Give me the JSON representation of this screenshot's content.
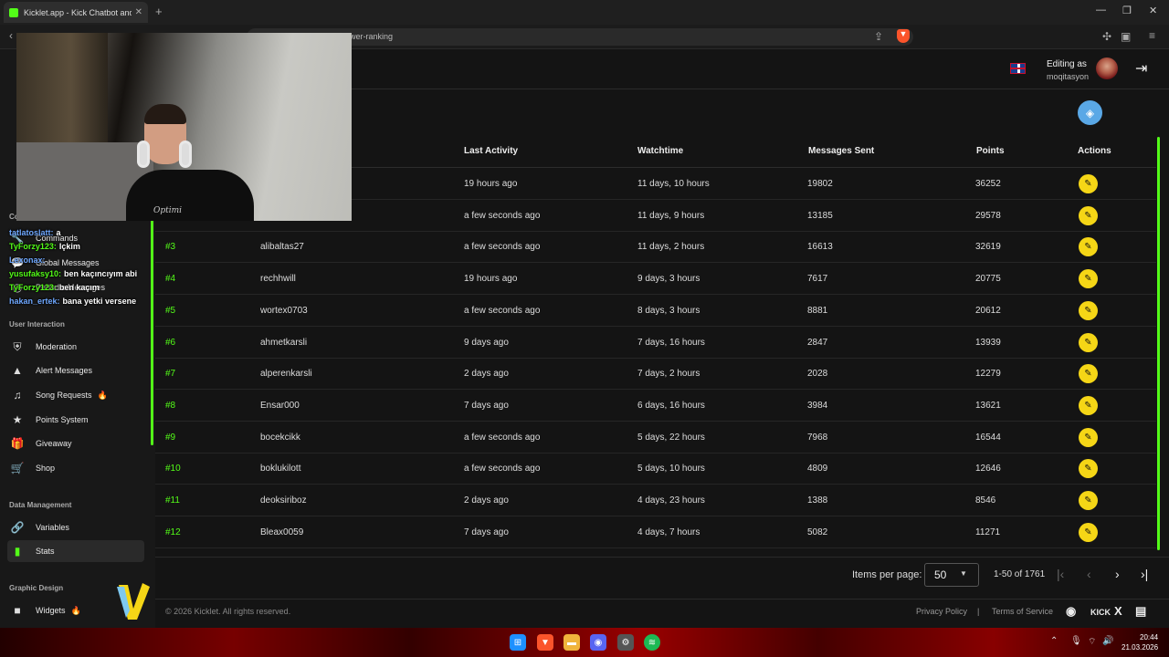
{
  "browser": {
    "tab_title": "Kicklet.app - Kick Chatbot and C",
    "tab_close": "✕",
    "new_tab": "+",
    "url": "iewer-ranking"
  },
  "header": {
    "editing_label": "Editing as",
    "username": "moqitasyon"
  },
  "sidebar": {
    "section_user_interaction": "User Interaction",
    "section_commands": "Co",
    "commands_items": [
      {
        "label": "Commands",
        "icon": "wrench-icon"
      },
      {
        "label": "Global Messages",
        "icon": "chat-bubble-icon"
      },
      {
        "label": "Periodic Messages",
        "icon": "clock-icon"
      }
    ],
    "user_interaction_items": [
      {
        "label": "Moderation",
        "icon": "shield-icon",
        "badge": ""
      },
      {
        "label": "Alert Messages",
        "icon": "alert-icon",
        "badge": ""
      },
      {
        "label": "Song Requests",
        "icon": "music-icon",
        "badge": "🔥"
      },
      {
        "label": "Points System",
        "icon": "star-icon",
        "badge": ""
      },
      {
        "label": "Giveaway",
        "icon": "gift-icon",
        "badge": ""
      },
      {
        "label": "Shop",
        "icon": "cart-icon",
        "badge": ""
      }
    ],
    "section_data_management": "Data Management",
    "data_items": [
      {
        "label": "Variables",
        "icon": "link-icon"
      },
      {
        "label": "Stats",
        "icon": "bar-chart-icon",
        "active": true
      }
    ],
    "section_graphic_design": "Graphic Design",
    "graphic_items": [
      {
        "label": "Widgets",
        "icon": "video-icon",
        "badge": "🔥"
      }
    ]
  },
  "table": {
    "columns": [
      "Last Activity",
      "Watchtime",
      "Messages Sent",
      "Points",
      "Actions"
    ],
    "rows": [
      {
        "rank": "",
        "user": "",
        "last": "19 hours ago",
        "watch": "11 days, 10 hours",
        "msgs": "19802",
        "points": "36252"
      },
      {
        "rank": "",
        "user": "",
        "last": "a few seconds ago",
        "watch": "11 days, 9 hours",
        "msgs": "13185",
        "points": "29578"
      },
      {
        "rank": "#3",
        "user": "alibaltas27",
        "last": "a few seconds ago",
        "watch": "11 days, 2 hours",
        "msgs": "16613",
        "points": "32619"
      },
      {
        "rank": "#4",
        "user": "rechhwill",
        "last": "19 hours ago",
        "watch": "9 days, 3 hours",
        "msgs": "7617",
        "points": "20775"
      },
      {
        "rank": "#5",
        "user": "wortex0703",
        "last": "a few seconds ago",
        "watch": "8 days, 3 hours",
        "msgs": "8881",
        "points": "20612"
      },
      {
        "rank": "#6",
        "user": "ahmetkarsli",
        "last": "9 days ago",
        "watch": "7 days, 16 hours",
        "msgs": "2847",
        "points": "13939"
      },
      {
        "rank": "#7",
        "user": "alperenkarsli",
        "last": "2 days ago",
        "watch": "7 days, 2 hours",
        "msgs": "2028",
        "points": "12279"
      },
      {
        "rank": "#8",
        "user": "Ensar000",
        "last": "7 days ago",
        "watch": "6 days, 16 hours",
        "msgs": "3984",
        "points": "13621"
      },
      {
        "rank": "#9",
        "user": "bocekcikk",
        "last": "a few seconds ago",
        "watch": "5 days, 22 hours",
        "msgs": "7968",
        "points": "16544"
      },
      {
        "rank": "#10",
        "user": "boklukilott",
        "last": "a few seconds ago",
        "watch": "5 days, 10 hours",
        "msgs": "4809",
        "points": "12646"
      },
      {
        "rank": "#11",
        "user": "deoksiriboz",
        "last": "2 days ago",
        "watch": "4 days, 23 hours",
        "msgs": "1388",
        "points": "8546"
      },
      {
        "rank": "#12",
        "user": "Bleax0059",
        "last": "7 days ago",
        "watch": "4 days, 7 hours",
        "msgs": "5082",
        "points": "11271"
      }
    ]
  },
  "pagination": {
    "items_per_page_label": "Items per page:",
    "items_per_page": "50",
    "range": "1-50 of 1761"
  },
  "footer": {
    "copyright": "© 2026 Kicklet. All rights reserved.",
    "privacy": "Privacy Policy",
    "separator": "|",
    "terms": "Terms of Service",
    "kick": "KICK",
    "x": "X"
  },
  "webcam": {
    "shirt_text": "Optimi"
  },
  "chat_overlay": [
    {
      "name": "tatlatoslatt:",
      "text": "a",
      "color": "#6fa8ff"
    },
    {
      "name": "TyForzy123:",
      "text": "Içkim",
      "color": "#53fc18"
    },
    {
      "name": "Lexonax:",
      "text": "",
      "color": "#6fa8ff"
    },
    {
      "name": "yusufaksy10:",
      "text": "ben kaçıncıyım abi",
      "color": "#53fc18"
    },
    {
      "name": "TyForzy123:",
      "text": "ben kaçım",
      "color": "#53fc18"
    },
    {
      "name": "hakan_ertek:",
      "text": "bana yetki versene",
      "color": "#6fa8ff"
    }
  ],
  "taskbar": {
    "time": "20:44",
    "date": "21.03.2026"
  },
  "colors": {
    "accent": "#53fc18",
    "action_button": "#f5d616",
    "fab": "#5aa8e6"
  }
}
